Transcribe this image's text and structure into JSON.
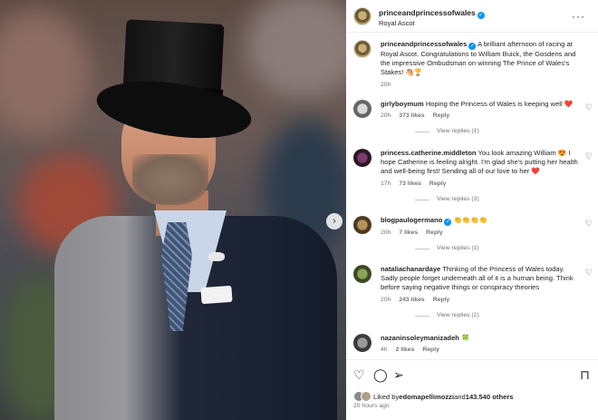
{
  "post": {
    "username": "princeandprincessofwales",
    "location": "Royal Ascot",
    "more_icon": "more-horizontal-icon",
    "caption_user": "princeandprincessofwales",
    "caption": "A brilliant afternoon of racing at Royal Ascot. Congratulations to William Buick, the Gosdens and the impressive Ombudsman on winning The Prince of Wales's Stakes! 🐴🏆",
    "caption_time": "20h"
  },
  "comments": [
    {
      "user": "girlyboymum",
      "text": "Hoping the Princess of Wales is keeping well ❤️",
      "time": "20h",
      "likes": "373 likes",
      "reply": "Reply",
      "view_replies": "View replies (1)"
    },
    {
      "user": "princess.catherine.middleton",
      "text": "You look amazing William 😍 I hope Catherine is feeling alright. I'm glad she's putting her health and well-being first! Sending all of our love to her ❤️",
      "time": "17h",
      "likes": "73 likes",
      "reply": "Reply",
      "view_replies": "View replies (3)"
    },
    {
      "user": "blogpaulogermano",
      "text": "👏👏👏👏",
      "time": "20h",
      "likes": "7 likes",
      "reply": "Reply",
      "view_replies": "View replies (1)"
    },
    {
      "user": "nataliachanardaye",
      "text": "Thinking of the Princess of Wales today. Sadly people forget underneath all of it is a human being. Think before saying negative things or conspiracy theories",
      "time": "20h",
      "likes": "243 likes",
      "reply": "Reply",
      "view_replies": "View replies (2)"
    },
    {
      "user": "nazaninsoleymanizadeh",
      "text": "🍀",
      "time": "4h",
      "likes": "2 likes",
      "reply": "Reply",
      "view_replies": ""
    }
  ],
  "actions": {
    "like_icon": "heart-icon",
    "comment_icon": "comment-icon",
    "share_icon": "send-icon",
    "save_icon": "bookmark-icon"
  },
  "liked_by": {
    "prefix": "Liked by ",
    "user": "edomapellimozzi",
    "and": " and ",
    "count": "143.540 others"
  },
  "posted": "20 hours ago",
  "colors": {
    "verified": "#0095f6",
    "muted": "#737373",
    "text": "#262626"
  }
}
